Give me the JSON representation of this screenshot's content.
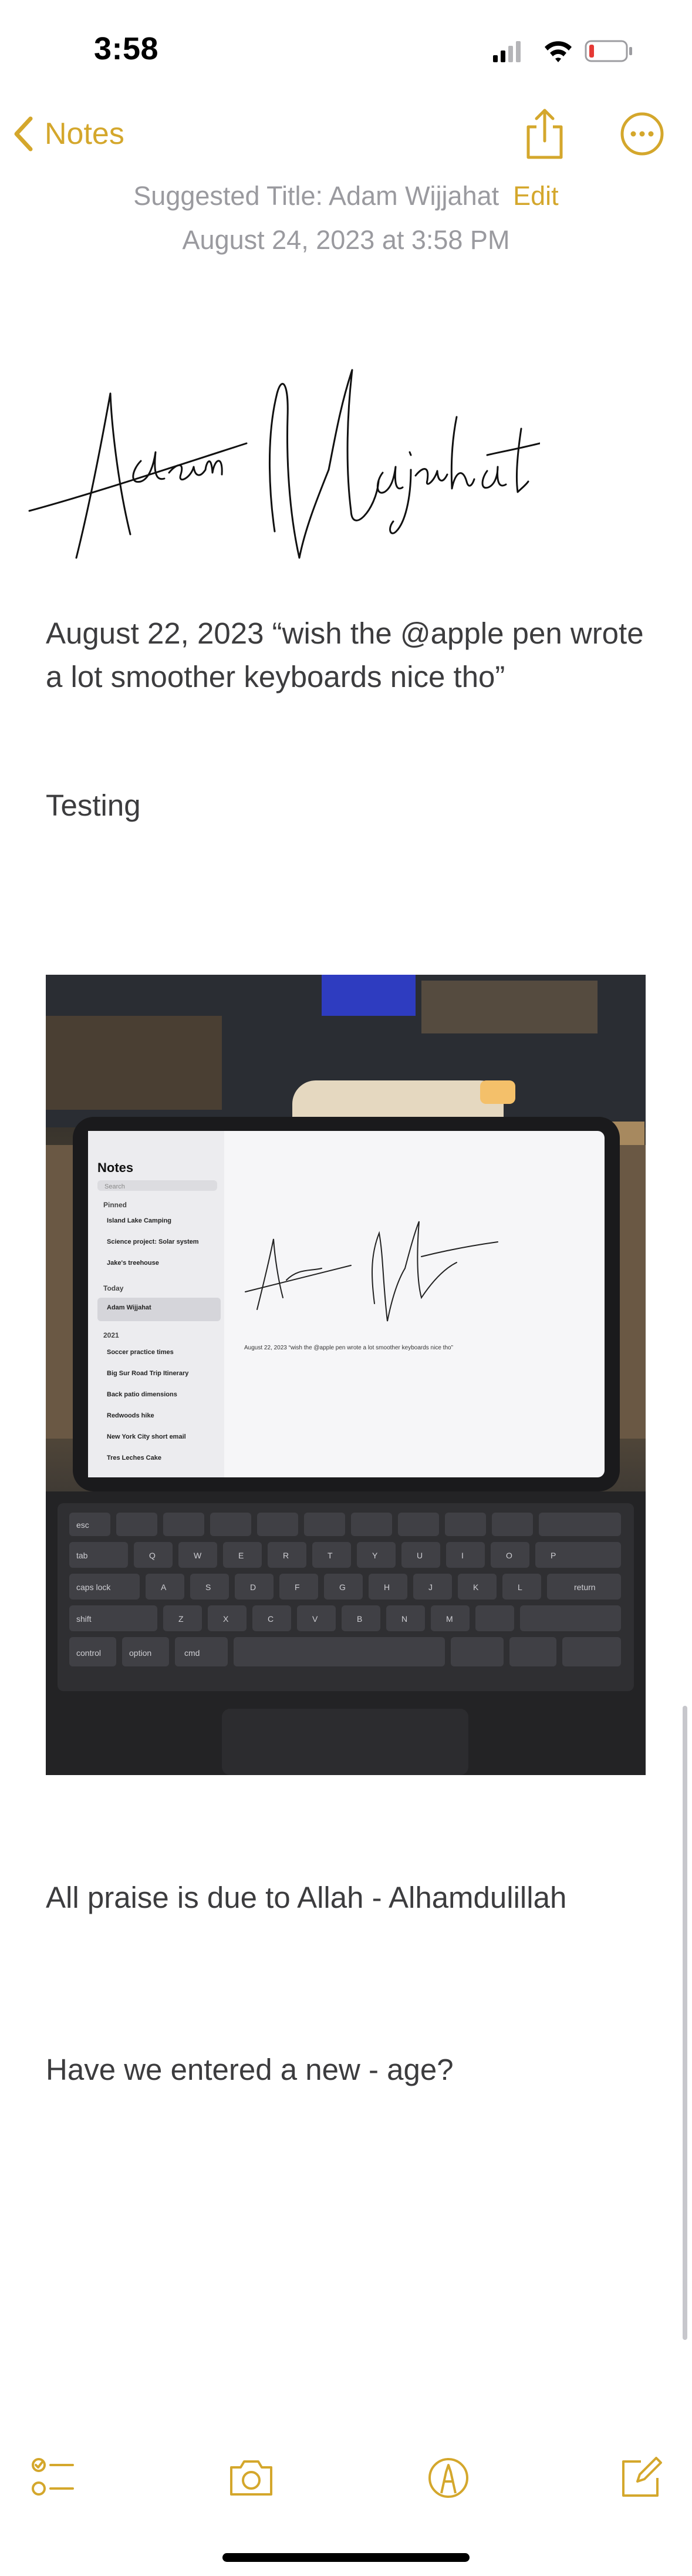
{
  "status_bar": {
    "time": "3:58",
    "icons": [
      "cellular-signal-icon",
      "wifi-icon",
      "battery-low-icon"
    ]
  },
  "nav": {
    "back_label": "Notes",
    "share_icon": "share-icon",
    "more_icon": "ellipsis-circle-icon"
  },
  "note": {
    "suggested_title": "Suggested Title: Adam Wijjahat",
    "edit_label": "Edit",
    "date": "August 24, 2023 at 3:58 PM",
    "signature_text": "Adam Wajahat",
    "paragraphs": [
      "August 22, 2023 “wish the @apple pen wrote a lot smoother keyboards nice tho”",
      "Testing",
      "All praise is due to Allah - Alhamdulillah",
      "Have we entered a new - age?"
    ],
    "photo": {
      "ipad_notes_heading": "Notes",
      "ipad_search_placeholder": "Search",
      "ipad_section_pinned": "Pinned",
      "ipad_section_today": "Today",
      "ipad_section_2021": "2021",
      "ipad_note_items": [
        "Island Lake Camping",
        "Science project: Solar system",
        "Jake's treehouse",
        "Adam Wijjahat",
        "Soccer practice times",
        "Big Sur Road Trip Itinerary",
        "Back patio dimensions",
        "Redwoods hike",
        "New York City short email",
        "Tres Leches Cake"
      ],
      "ipad_note_caption": "August 22, 2023 “wish the @apple pen wrote a lot smoother keyboards nice tho”",
      "ipad_signature": "Adam Wajahat",
      "keyboard_keys": [
        "esc",
        "Q",
        "W",
        "E",
        "R",
        "T",
        "Y",
        "U",
        "I",
        "O",
        "P",
        "A",
        "S",
        "D",
        "F",
        "G",
        "H",
        "J",
        "K",
        "L",
        "Z",
        "X",
        "C",
        "V",
        "B",
        "N",
        "M",
        "tab",
        "caps lock",
        "shift",
        "return",
        "control",
        "option",
        "cmd"
      ]
    }
  },
  "toolbar": {
    "items": [
      "checklist-icon",
      "camera-icon",
      "markup-pen-icon",
      "compose-icon"
    ]
  },
  "colors": {
    "accent": "#d4a72c",
    "meta_text": "#9a9a9f",
    "body_text": "#3c3c3e"
  }
}
